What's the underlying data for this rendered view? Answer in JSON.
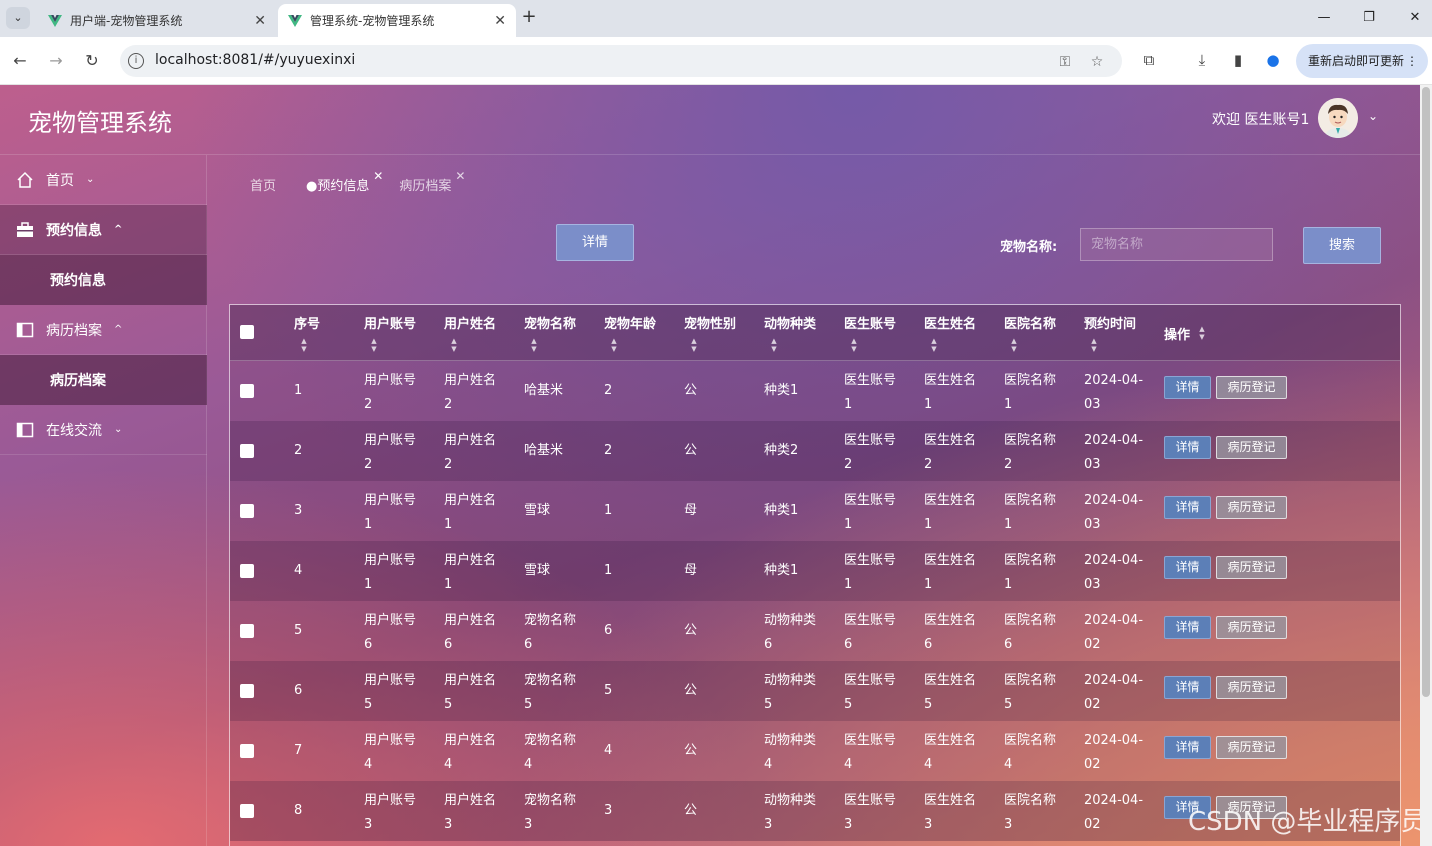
{
  "browser": {
    "tabs": [
      {
        "title": "用户端-宠物管理系统",
        "active": false
      },
      {
        "title": "管理系统-宠物管理系统",
        "active": true
      }
    ],
    "url": "localhost:8081/#/yuyuexinxi",
    "update_label": "重新启动即可更新"
  },
  "app": {
    "title": "宠物管理系统",
    "welcome": "欢迎 医生账号1"
  },
  "sidebar": {
    "items": [
      {
        "label": "首页",
        "icon": "home-icon"
      },
      {
        "label": "预约信息",
        "icon": "briefcase-icon",
        "sub": "预约信息"
      },
      {
        "label": "病历档案",
        "icon": "panel-icon",
        "sub": "病历档案"
      },
      {
        "label": "在线交流",
        "icon": "panel-icon"
      }
    ]
  },
  "breadcrumbs": [
    "首页",
    "●预约信息",
    "病历档案"
  ],
  "toolbar": {
    "detail_label": "详情",
    "search_label": "宠物名称:",
    "search_placeholder": "宠物名称",
    "search_button": "搜索"
  },
  "table": {
    "headers": [
      "序号",
      "用户账号",
      "用户姓名",
      "宠物名称",
      "宠物年龄",
      "宠物性别",
      "动物种类",
      "医生账号",
      "医生姓名",
      "医院名称",
      "预约时间",
      "操作"
    ],
    "actions": {
      "detail": "详情",
      "record": "病历登记"
    },
    "rows": [
      [
        "1",
        "用户账号\n2",
        "用户姓名\n2",
        "哈基米",
        "2",
        "公",
        "种类1",
        "医生账号\n1",
        "医生姓名\n1",
        "医院名称\n1",
        "2024-04-\n03"
      ],
      [
        "2",
        "用户账号\n2",
        "用户姓名\n2",
        "哈基米",
        "2",
        "公",
        "种类2",
        "医生账号\n2",
        "医生姓名\n2",
        "医院名称\n2",
        "2024-04-\n03"
      ],
      [
        "3",
        "用户账号\n1",
        "用户姓名\n1",
        "雪球",
        "1",
        "母",
        "种类1",
        "医生账号\n1",
        "医生姓名\n1",
        "医院名称\n1",
        "2024-04-\n03"
      ],
      [
        "4",
        "用户账号\n1",
        "用户姓名\n1",
        "雪球",
        "1",
        "母",
        "种类1",
        "医生账号\n1",
        "医生姓名\n1",
        "医院名称\n1",
        "2024-04-\n03"
      ],
      [
        "5",
        "用户账号\n6",
        "用户姓名\n6",
        "宠物名称\n6",
        "6",
        "公",
        "动物种类\n6",
        "医生账号\n6",
        "医生姓名\n6",
        "医院名称\n6",
        "2024-04-\n02"
      ],
      [
        "6",
        "用户账号\n5",
        "用户姓名\n5",
        "宠物名称\n5",
        "5",
        "公",
        "动物种类\n5",
        "医生账号\n5",
        "医生姓名\n5",
        "医院名称\n5",
        "2024-04-\n02"
      ],
      [
        "7",
        "用户账号\n4",
        "用户姓名\n4",
        "宠物名称\n4",
        "4",
        "公",
        "动物种类\n4",
        "医生账号\n4",
        "医生姓名\n4",
        "医院名称\n4",
        "2024-04-\n02"
      ],
      [
        "8",
        "用户账号\n3",
        "用户姓名\n3",
        "宠物名称\n3",
        "3",
        "公",
        "动物种类\n3",
        "医生账号\n3",
        "医生姓名\n3",
        "医院名称\n3",
        "2024-04-\n02"
      ]
    ]
  },
  "watermark": "CSDN @毕业程序员",
  "colors": {
    "button": "#7b8ec9",
    "mini_button": "#5c7fb7"
  }
}
